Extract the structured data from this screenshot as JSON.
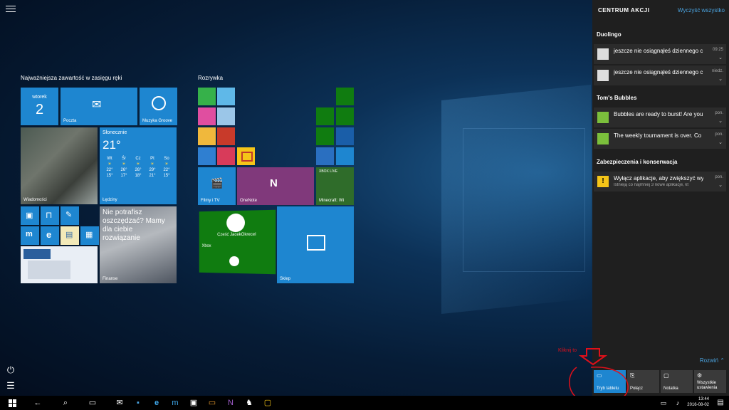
{
  "start": {
    "group1_title": "Najważniejsza zawartość w zasięgu ręki",
    "group2_title": "Rozrywka",
    "calendar": {
      "day_name": "wtorek",
      "day_num": "2"
    },
    "poczta": "Poczta",
    "muzyka": "Muzyka Groove",
    "wiadomosci": "Wiadomości",
    "weather": {
      "title": "Słonecznie",
      "temp": "21°",
      "location": "Łędziny",
      "days": [
        {
          "d": "Wt",
          "hi": "22°",
          "lo": "15°"
        },
        {
          "d": "Śr",
          "hi": "26°",
          "lo": "17°"
        },
        {
          "d": "Cz",
          "hi": "26°",
          "lo": "18°"
        },
        {
          "d": "Pt",
          "hi": "29°",
          "lo": "21°"
        },
        {
          "d": "So",
          "hi": "22°",
          "lo": "15°"
        }
      ]
    },
    "finanse_text": "Nie potrafisz oszczędzać? Mamy dla ciebie rozwiązanie",
    "finanse": "Finanse",
    "filmy": "Filmy i TV",
    "onenote": "OneNote",
    "xbox_live": "XBOX LIVE",
    "minecraft": "Minecraft: Wi",
    "xbox_cube": "Cześć JacekOkrecel",
    "xbox_label": "Xbox",
    "sklep": "Sklep"
  },
  "action_center": {
    "title": "CENTRUM AKCJI",
    "clear_all": "Wyczyść wszystko",
    "groups": [
      {
        "name": "Duolingo",
        "items": [
          {
            "text": "jeszcze nie osiągnąłeś dziennego c",
            "sub": "",
            "time": "09:25"
          },
          {
            "text": "jeszcze nie osiągnąłeś dziennego c",
            "sub": "",
            "time": "niedz."
          }
        ]
      },
      {
        "name": "Tom's Bubbles",
        "items": [
          {
            "text": "Bubbles are ready to burst! Are you",
            "sub": "",
            "time": "pon."
          },
          {
            "text": "The weekly tournament is over. Co",
            "sub": "",
            "time": "pon."
          }
        ]
      },
      {
        "name": "Zabezpieczenia i konserwacja",
        "items": [
          {
            "text": "Wyłącz aplikacje, aby zwiększyć wy",
            "sub": "Istnieją co najmniej 3 nowe aplikacje, kt",
            "time": "pon."
          }
        ]
      }
    ],
    "expand": "Rozwiń",
    "quick_actions": [
      {
        "label": "Tryb tabletu",
        "icon": "tablet-icon"
      },
      {
        "label": "Połącz",
        "icon": "connect-icon"
      },
      {
        "label": "Notatka",
        "icon": "note-icon"
      },
      {
        "label": "Wszystkie ustawienia",
        "icon": "gear-icon"
      }
    ]
  },
  "annotation": {
    "text": "Kliknij to",
    "color": "#e0101a"
  },
  "taskbar": {
    "time": "13:44",
    "date": "2016-08-02"
  },
  "colors": {
    "tile_blue": "#1e86d0",
    "onenote_purple": "#80397b",
    "xbox_green": "#107c10",
    "accent_link": "#4aa3df"
  }
}
